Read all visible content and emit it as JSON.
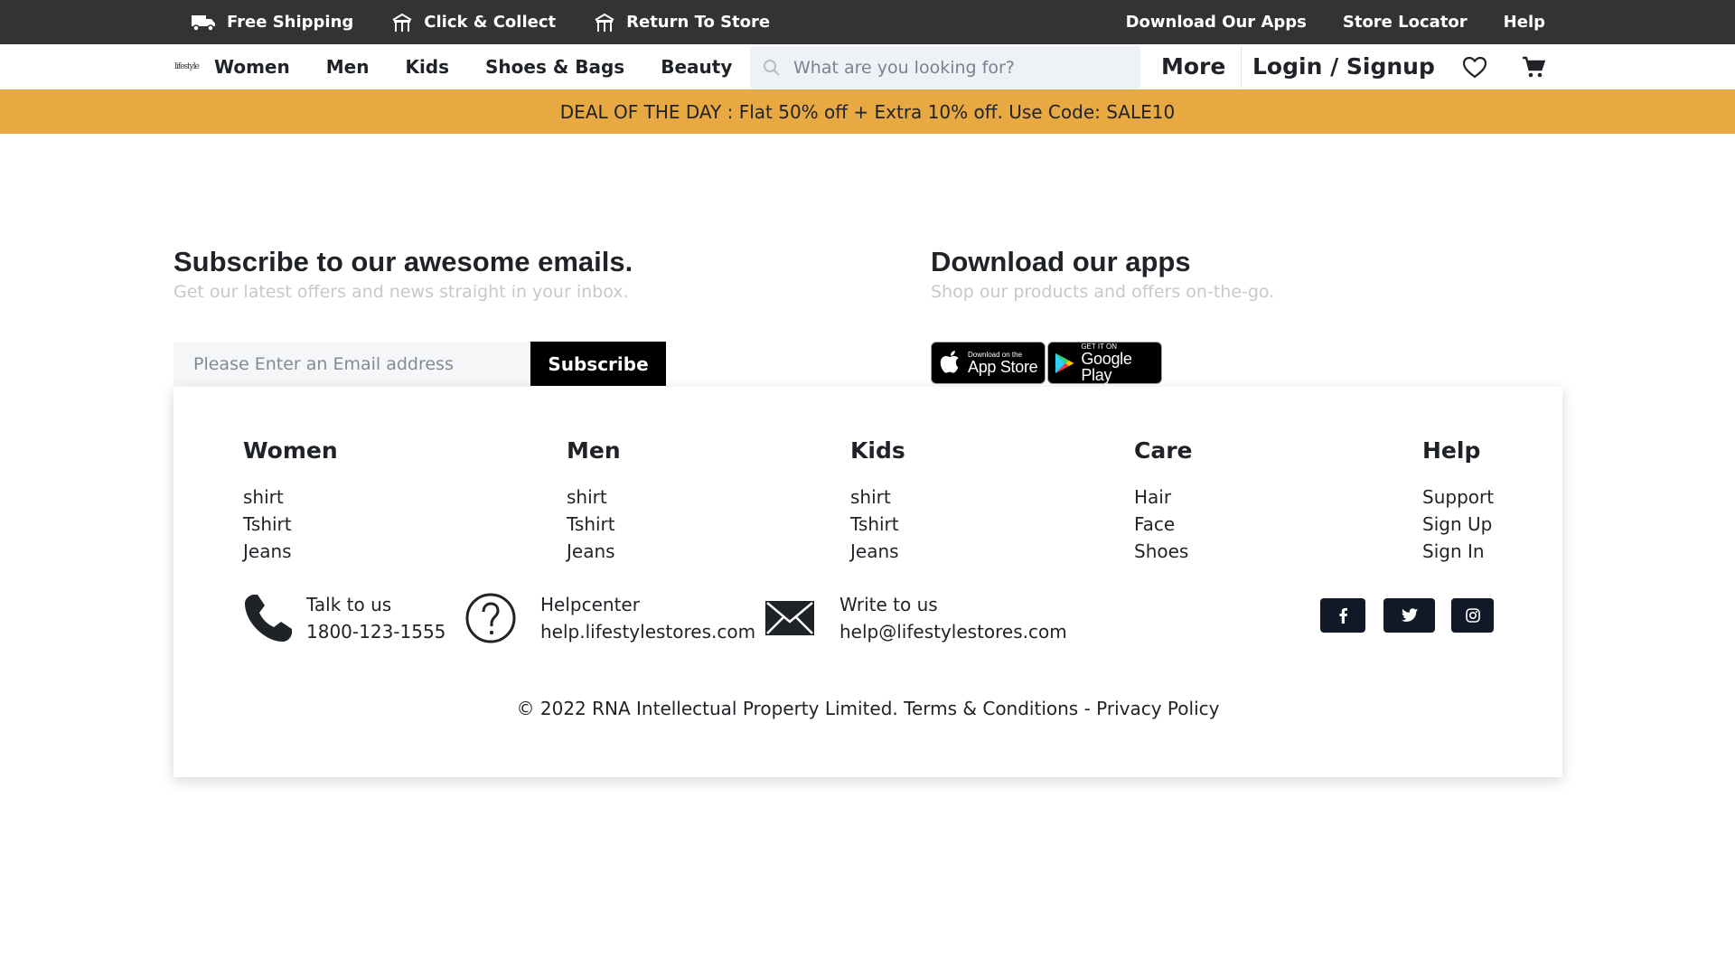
{
  "topbar": {
    "left_items": [
      {
        "label": "Free Shipping",
        "icon": "truck-icon"
      },
      {
        "label": "Click & Collect",
        "icon": "store-icon"
      },
      {
        "label": "Return To Store",
        "icon": "store-icon"
      }
    ],
    "right_links": [
      "Download Our Apps",
      "Store Locator",
      "Help"
    ],
    "background": "#333333"
  },
  "navbar": {
    "logo_text": "lifestyle",
    "links": [
      "Women",
      "Men",
      "Kids",
      "Shoes & Bags",
      "Beauty"
    ],
    "search": {
      "placeholder": "What are you looking for?",
      "value": ""
    },
    "more_label": "More",
    "login_label": "Login / Signup",
    "icons": [
      "heart-icon",
      "cart-icon"
    ]
  },
  "deal_banner": {
    "text": "DEAL OF THE DAY : Flat 50% off + Extra 10% off. Use Code: SALE10",
    "background": "#e8a842"
  },
  "subscribe": {
    "title": "Subscribe to our awesome emails.",
    "description": "Get our latest offers and news straight in your inbox.",
    "email_placeholder": "Please Enter an Email address",
    "button_label": "Subscribe"
  },
  "apps": {
    "title": "Download our apps",
    "description": "Shop our products and offers on-the-go.",
    "appstore": {
      "small": "Download on the",
      "big": "App Store"
    },
    "playstore": {
      "small": "GET IT ON",
      "big": "Google Play"
    }
  },
  "footer": {
    "columns": [
      {
        "title": "Women",
        "items": [
          "shirt",
          "Tshirt",
          "Jeans"
        ]
      },
      {
        "title": "Men",
        "items": [
          "shirt",
          "Tshirt",
          "Jeans"
        ]
      },
      {
        "title": "Kids",
        "items": [
          "shirt",
          "Tshirt",
          "Jeans"
        ]
      },
      {
        "title": "Care",
        "items": [
          "Hair",
          "Face",
          "Shoes"
        ]
      },
      {
        "title": "Help",
        "items": [
          "Support",
          "Sign Up",
          "Sign In"
        ]
      }
    ],
    "contacts": [
      {
        "icon": "phone-icon",
        "line1": "Talk to us",
        "line2": "1800-123-1555"
      },
      {
        "icon": "question-icon",
        "line1": "Helpcenter",
        "line2": "help.lifestylestores.com"
      },
      {
        "icon": "mail-icon",
        "line1": "Write to us",
        "line2": "help@lifestylestores.com"
      }
    ],
    "social": [
      "facebook-icon",
      "twitter-icon",
      "instagram-icon"
    ],
    "copyright": "© 2022 RNA Intellectual Property Limited.",
    "terms": "Terms & Conditions",
    "separator": "-",
    "privacy": "Privacy Policy"
  }
}
